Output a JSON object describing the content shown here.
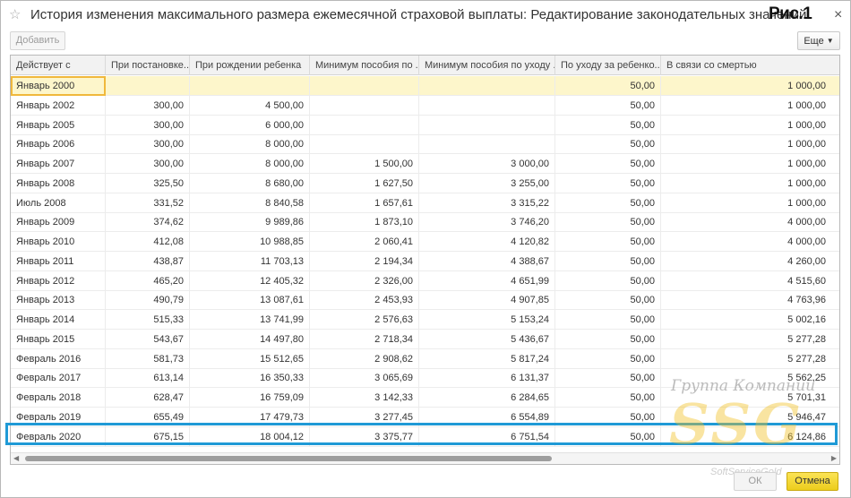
{
  "window": {
    "title": "История изменения максимального размера ежемесячной страховой выплаты: Редактирование законодательных значений",
    "figure_label": "Рис.1",
    "close_glyph": "×"
  },
  "toolbar": {
    "add_label": "Добавить",
    "more_label": "Еще"
  },
  "table": {
    "headers": [
      "Действует с",
      "При постановке...",
      "При рождении ребенка",
      "Минимум пособия по ...",
      "Минимум пособия по уходу ...",
      "По уходу за ребенко...",
      "В связи со смертью"
    ],
    "rows": [
      [
        "Январь 2000",
        "",
        "",
        "",
        "",
        "50,00",
        "1 000,00"
      ],
      [
        "Январь 2002",
        "300,00",
        "4 500,00",
        "",
        "",
        "50,00",
        "1 000,00"
      ],
      [
        "Январь 2005",
        "300,00",
        "6 000,00",
        "",
        "",
        "50,00",
        "1 000,00"
      ],
      [
        "Январь 2006",
        "300,00",
        "8 000,00",
        "",
        "",
        "50,00",
        "1 000,00"
      ],
      [
        "Январь 2007",
        "300,00",
        "8 000,00",
        "1 500,00",
        "3 000,00",
        "50,00",
        "1 000,00"
      ],
      [
        "Январь 2008",
        "325,50",
        "8 680,00",
        "1 627,50",
        "3 255,00",
        "50,00",
        "1 000,00"
      ],
      [
        "Июль 2008",
        "331,52",
        "8 840,58",
        "1 657,61",
        "3 315,22",
        "50,00",
        "1 000,00"
      ],
      [
        "Январь 2009",
        "374,62",
        "9 989,86",
        "1 873,10",
        "3 746,20",
        "50,00",
        "4 000,00"
      ],
      [
        "Январь 2010",
        "412,08",
        "10 988,85",
        "2 060,41",
        "4 120,82",
        "50,00",
        "4 000,00"
      ],
      [
        "Январь 2011",
        "438,87",
        "11 703,13",
        "2 194,34",
        "4 388,67",
        "50,00",
        "4 260,00"
      ],
      [
        "Январь 2012",
        "465,20",
        "12 405,32",
        "2 326,00",
        "4 651,99",
        "50,00",
        "4 515,60"
      ],
      [
        "Январь 2013",
        "490,79",
        "13 087,61",
        "2 453,93",
        "4 907,85",
        "50,00",
        "4 763,96"
      ],
      [
        "Январь 2014",
        "515,33",
        "13 741,99",
        "2 576,63",
        "5 153,24",
        "50,00",
        "5 002,16"
      ],
      [
        "Январь 2015",
        "543,67",
        "14 497,80",
        "2 718,34",
        "5 436,67",
        "50,00",
        "5 277,28"
      ],
      [
        "Февраль 2016",
        "581,73",
        "15 512,65",
        "2 908,62",
        "5 817,24",
        "50,00",
        "5 277,28"
      ],
      [
        "Февраль 2017",
        "613,14",
        "16 350,33",
        "3 065,69",
        "6 131,37",
        "50,00",
        "5 562,25"
      ],
      [
        "Февраль 2018",
        "628,47",
        "16 759,09",
        "3 142,33",
        "6 284,65",
        "50,00",
        "5 701,31"
      ],
      [
        "Февраль 2019",
        "655,49",
        "17 479,73",
        "3 277,45",
        "6 554,89",
        "50,00",
        "5 946,47"
      ],
      [
        "Февраль 2020",
        "675,15",
        "18 004,12",
        "3 375,77",
        "6 751,54",
        "50,00",
        "6 124,86"
      ]
    ]
  },
  "watermark": {
    "line1": "Группа Компаний",
    "main": "SSG",
    "line2": "SoftServiceGold"
  },
  "footer": {
    "ok_label": "ОК",
    "cancel_label": "Отмена"
  },
  "colors": {
    "first_row_bg": "#fdf6cb",
    "highlight_border": "#1f9ad6",
    "cancel_button": "#f4d533"
  }
}
